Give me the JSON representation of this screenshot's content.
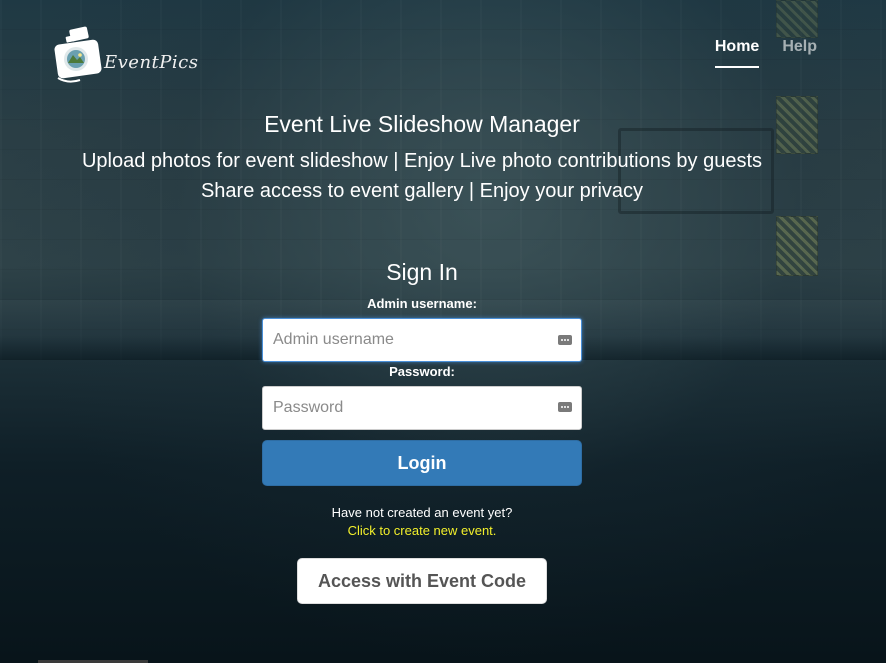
{
  "header": {
    "logo_text": "EventPics",
    "nav": [
      {
        "label": "Home",
        "active": true
      },
      {
        "label": "Help",
        "active": false
      }
    ]
  },
  "hero": {
    "title": "Event Live Slideshow Manager",
    "line1": "Upload photos for event slideshow | Enjoy Live photo contributions by guests",
    "line2": "Share access to event gallery | Enjoy your privacy"
  },
  "signin": {
    "title": "Sign In",
    "username_label": "Admin username:",
    "username_placeholder": "Admin username",
    "username_value": "",
    "password_label": "Password:",
    "password_placeholder": "Password",
    "password_value": "",
    "login_label": "Login",
    "prompt": "Have not created an event yet?",
    "create_link": "Click to create new event.",
    "event_code_label": "Access with Event Code"
  },
  "icons": {
    "logo": "camera-logo-icon",
    "field_autofill": "password-manager-icon"
  },
  "colors": {
    "accent": "#337ab7",
    "link": "#f2ef2b",
    "focus": "#4a90d9"
  }
}
